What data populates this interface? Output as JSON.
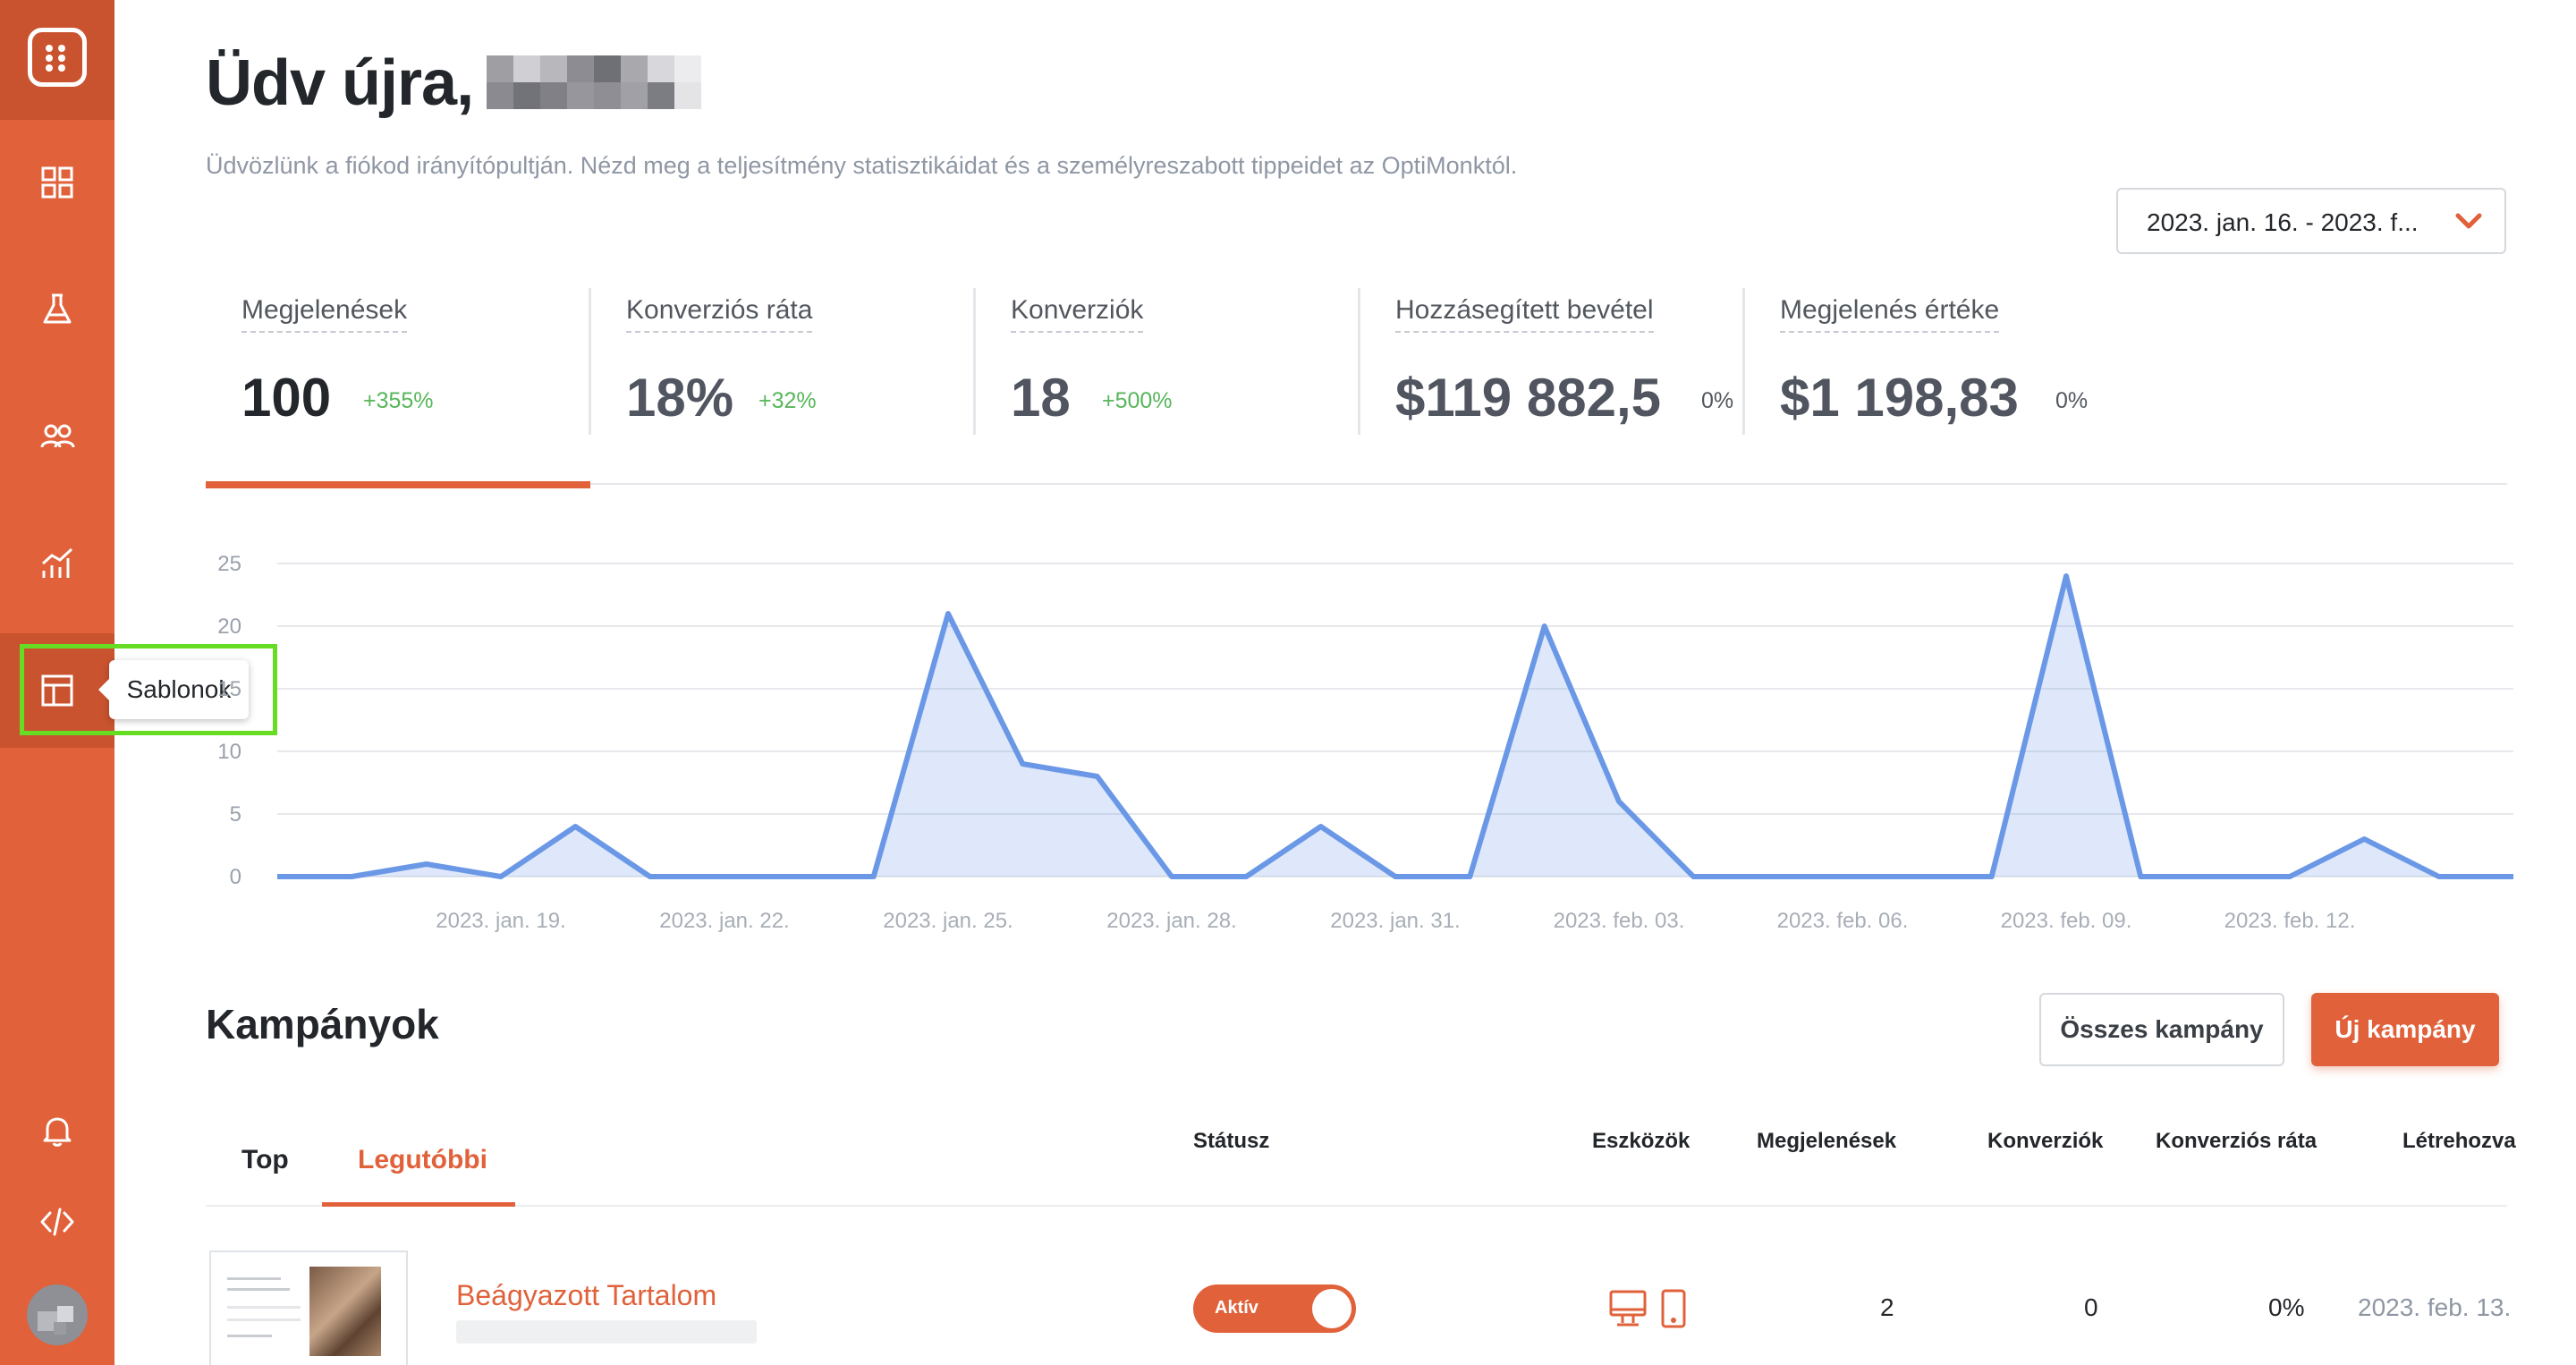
{
  "sidebar": {
    "items": [
      {
        "name": "dashboard",
        "icon": "dashboard-grid-icon"
      },
      {
        "name": "experiments",
        "icon": "flask-icon"
      },
      {
        "name": "audience",
        "icon": "users-icon"
      },
      {
        "name": "analytics",
        "icon": "chart-icon"
      },
      {
        "name": "templates",
        "icon": "layout-icon"
      }
    ],
    "bottom": [
      {
        "name": "notifications",
        "icon": "bell-icon"
      },
      {
        "name": "embed-code",
        "icon": "code-icon"
      }
    ],
    "tooltip": "Sablonok"
  },
  "header": {
    "title": "Üdv újra,",
    "subtitle": "Üdvözlünk a fiókod irányítópultján. Nézd meg a teljesítmény statisztikáidat és a személyreszabott tippeidet az OptiMonktól.",
    "date_range": "2023. jan. 16. - 2023. f..."
  },
  "kpis": [
    {
      "label": "Megjelenések",
      "value": "100",
      "change": "+355%"
    },
    {
      "label": "Konverziós ráta",
      "value": "18%",
      "change": "+32%"
    },
    {
      "label": "Konverziók",
      "value": "18",
      "change": "+500%"
    },
    {
      "label": "Hozzásegített bevétel",
      "value": "$119 882,5",
      "change": "0%"
    },
    {
      "label": "Megjelenés értéke",
      "value": "$1 198,83",
      "change": "0%"
    }
  ],
  "chart_data": {
    "type": "area",
    "x_tick_labels": [
      "2023. jan. 19.",
      "2023. jan. 22.",
      "2023. jan. 25.",
      "2023. jan. 28.",
      "2023. jan. 31.",
      "2023. feb. 03.",
      "2023. feb. 06.",
      "2023. feb. 09.",
      "2023. feb. 12."
    ],
    "y_ticks": [
      0,
      5,
      10,
      15,
      20,
      25
    ],
    "ylim": [
      0,
      25
    ],
    "grid": true,
    "series": [
      {
        "values": [
          0,
          0,
          1,
          0,
          4,
          0,
          0,
          0,
          0,
          21,
          9,
          8,
          0,
          0,
          4,
          0,
          0,
          20,
          6,
          0,
          0,
          0,
          0,
          0,
          24,
          0,
          0,
          0,
          3,
          0,
          0
        ],
        "color": "#6b98e6"
      }
    ]
  },
  "campaigns": {
    "title": "Kampányok",
    "all_button": "Összes kampány",
    "new_button": "Új kampány",
    "tabs": [
      "Top",
      "Legutóbbi"
    ],
    "active_tab": "Legutóbbi",
    "columns": [
      "Státusz",
      "Eszközök",
      "Megjelenések",
      "Konverziók",
      "Konverziós ráta",
      "Létrehozva"
    ],
    "rows": [
      {
        "name": "Beágyazott Tartalom",
        "status": "Aktív",
        "devices": [
          "desktop-icon",
          "mobile-icon"
        ],
        "impressions": "2",
        "conversions": "0",
        "conversion_rate": "0%",
        "created": "2023. feb. 13."
      }
    ]
  },
  "colors": {
    "accent": "#e0613a",
    "positive": "#58b65a",
    "chart_line": "#6b98e6",
    "highlight": "#66dd22"
  }
}
